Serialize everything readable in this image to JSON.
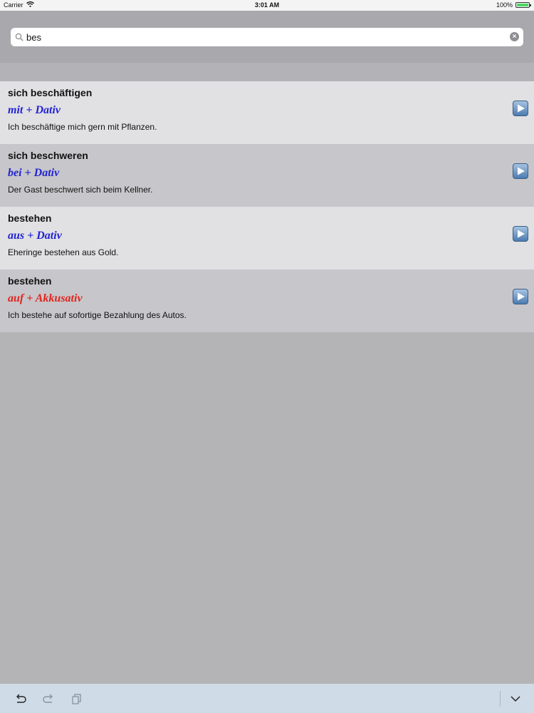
{
  "status_bar": {
    "carrier": "Carrier",
    "time": "3:01 AM",
    "battery": "100%",
    "battery_level": 1.0,
    "wifi_icon": "wifi-icon"
  },
  "search": {
    "value": "bes",
    "icons": [
      "search-icon",
      "clear-icon"
    ]
  },
  "colors": {
    "dativ": "#2323d4",
    "akkusativ": "#e0251f"
  },
  "results": [
    {
      "word": "sich beschäftigen",
      "case": "mit + Dativ",
      "case_type": "dativ",
      "example": "Ich beschäftige mich gern mit Pflanzen."
    },
    {
      "word": "sich beschweren",
      "case": "bei + Dativ",
      "case_type": "dativ",
      "example": "Der Gast beschwert sich beim Kellner."
    },
    {
      "word": "bestehen",
      "case": "aus + Dativ",
      "case_type": "dativ",
      "example": "Eheringe bestehen aus Gold."
    },
    {
      "word": "bestehen",
      "case": "auf + Akkusativ",
      "case_type": "akkusativ",
      "example": "Ich bestehe auf sofortige Bezahlung des Autos."
    }
  ],
  "toolbar": {
    "icons": [
      "undo-icon",
      "redo-icon",
      "copy-icon",
      "chevron-down-icon"
    ]
  }
}
